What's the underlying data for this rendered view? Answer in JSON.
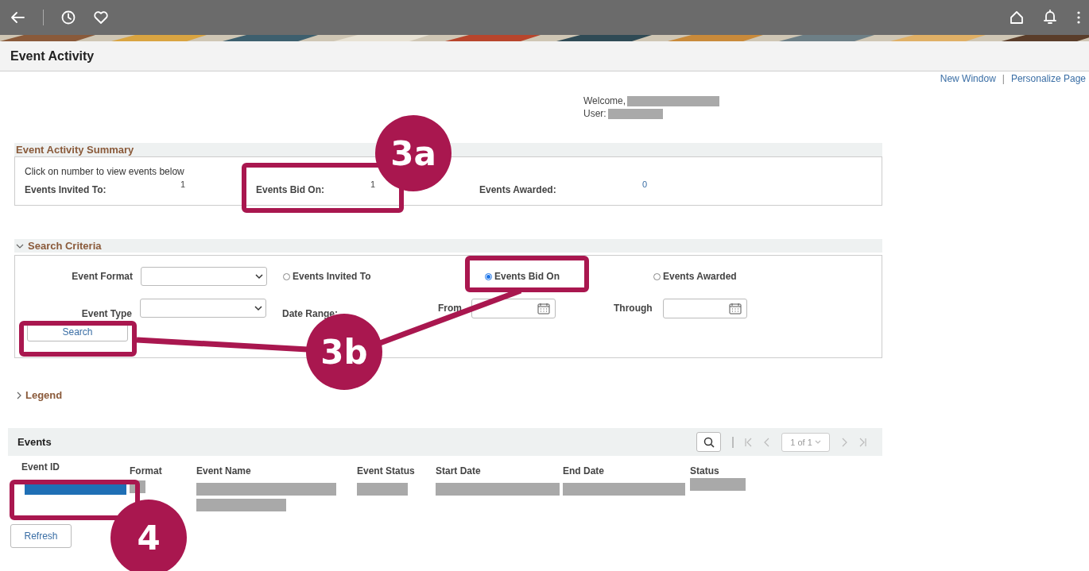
{
  "page_title": "Event Activity",
  "header_links": [
    "New Window",
    "Personalize Page"
  ],
  "link_separator": "|",
  "welcome": {
    "welcome_label": "Welcome,",
    "user_label": "User:",
    "redacted": true
  },
  "summary": {
    "title": "Event Activity Summary",
    "hint": "Click on number to view events below",
    "counts": [
      {
        "label": "Events Invited To:",
        "value": "1",
        "kind": "plain"
      },
      {
        "label": "Events Bid On:",
        "value": "1",
        "kind": "plain"
      },
      {
        "label": "Events Awarded:",
        "value": "0",
        "kind": "link"
      }
    ]
  },
  "search_criteria": {
    "title": "Search Criteria",
    "expanded": true,
    "event_format_label": "Event Format",
    "event_type_label": "Event Type",
    "radios": [
      {
        "label": "Events Invited To",
        "selected": false
      },
      {
        "label": "Events Bid On",
        "selected": true
      },
      {
        "label": "Events Awarded",
        "selected": false
      }
    ],
    "date_range_label": "Date Range:",
    "from_label": "From",
    "through_label": "Through",
    "search_button": "Search"
  },
  "legend": {
    "title": "Legend",
    "expanded": false
  },
  "events": {
    "title": "Events",
    "page_selector": "1 of 1",
    "columns": [
      "Event ID",
      "Format",
      "Event Name",
      "Event Status",
      "Start Date",
      "End Date",
      "Status"
    ],
    "rows": [
      {
        "cells": [
          {
            "kind": "link",
            "redacted": true
          },
          {
            "kind": "text",
            "redacted": true
          },
          {
            "kind": "text",
            "redacted": true
          },
          {
            "kind": "text",
            "redacted": true
          },
          {
            "kind": "text",
            "redacted": true
          },
          {
            "kind": "text",
            "redacted": true
          },
          {
            "kind": "text",
            "redacted": true
          }
        ]
      }
    ]
  },
  "refresh_button": "Refresh",
  "annotations": [
    {
      "label": "3a"
    },
    {
      "label": "3b"
    },
    {
      "label": "4"
    }
  ]
}
